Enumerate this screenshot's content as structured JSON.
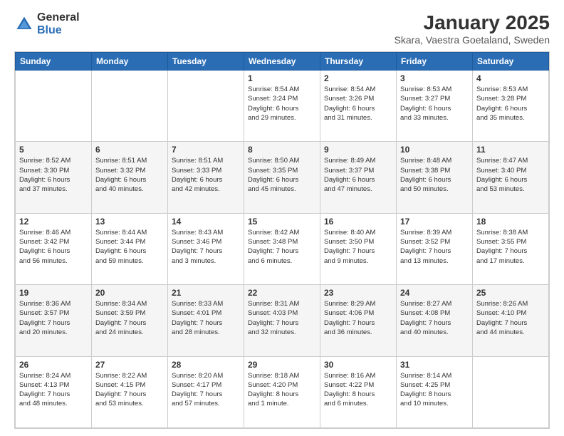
{
  "logo": {
    "general": "General",
    "blue": "Blue"
  },
  "title": "January 2025",
  "subtitle": "Skara, Vaestra Goetaland, Sweden",
  "days_of_week": [
    "Sunday",
    "Monday",
    "Tuesday",
    "Wednesday",
    "Thursday",
    "Friday",
    "Saturday"
  ],
  "weeks": [
    [
      {
        "day": "",
        "info": ""
      },
      {
        "day": "",
        "info": ""
      },
      {
        "day": "",
        "info": ""
      },
      {
        "day": "1",
        "info": "Sunrise: 8:54 AM\nSunset: 3:24 PM\nDaylight: 6 hours\nand 29 minutes."
      },
      {
        "day": "2",
        "info": "Sunrise: 8:54 AM\nSunset: 3:26 PM\nDaylight: 6 hours\nand 31 minutes."
      },
      {
        "day": "3",
        "info": "Sunrise: 8:53 AM\nSunset: 3:27 PM\nDaylight: 6 hours\nand 33 minutes."
      },
      {
        "day": "4",
        "info": "Sunrise: 8:53 AM\nSunset: 3:28 PM\nDaylight: 6 hours\nand 35 minutes."
      }
    ],
    [
      {
        "day": "5",
        "info": "Sunrise: 8:52 AM\nSunset: 3:30 PM\nDaylight: 6 hours\nand 37 minutes."
      },
      {
        "day": "6",
        "info": "Sunrise: 8:51 AM\nSunset: 3:32 PM\nDaylight: 6 hours\nand 40 minutes."
      },
      {
        "day": "7",
        "info": "Sunrise: 8:51 AM\nSunset: 3:33 PM\nDaylight: 6 hours\nand 42 minutes."
      },
      {
        "day": "8",
        "info": "Sunrise: 8:50 AM\nSunset: 3:35 PM\nDaylight: 6 hours\nand 45 minutes."
      },
      {
        "day": "9",
        "info": "Sunrise: 8:49 AM\nSunset: 3:37 PM\nDaylight: 6 hours\nand 47 minutes."
      },
      {
        "day": "10",
        "info": "Sunrise: 8:48 AM\nSunset: 3:38 PM\nDaylight: 6 hours\nand 50 minutes."
      },
      {
        "day": "11",
        "info": "Sunrise: 8:47 AM\nSunset: 3:40 PM\nDaylight: 6 hours\nand 53 minutes."
      }
    ],
    [
      {
        "day": "12",
        "info": "Sunrise: 8:46 AM\nSunset: 3:42 PM\nDaylight: 6 hours\nand 56 minutes."
      },
      {
        "day": "13",
        "info": "Sunrise: 8:44 AM\nSunset: 3:44 PM\nDaylight: 6 hours\nand 59 minutes."
      },
      {
        "day": "14",
        "info": "Sunrise: 8:43 AM\nSunset: 3:46 PM\nDaylight: 7 hours\nand 3 minutes."
      },
      {
        "day": "15",
        "info": "Sunrise: 8:42 AM\nSunset: 3:48 PM\nDaylight: 7 hours\nand 6 minutes."
      },
      {
        "day": "16",
        "info": "Sunrise: 8:40 AM\nSunset: 3:50 PM\nDaylight: 7 hours\nand 9 minutes."
      },
      {
        "day": "17",
        "info": "Sunrise: 8:39 AM\nSunset: 3:52 PM\nDaylight: 7 hours\nand 13 minutes."
      },
      {
        "day": "18",
        "info": "Sunrise: 8:38 AM\nSunset: 3:55 PM\nDaylight: 7 hours\nand 17 minutes."
      }
    ],
    [
      {
        "day": "19",
        "info": "Sunrise: 8:36 AM\nSunset: 3:57 PM\nDaylight: 7 hours\nand 20 minutes."
      },
      {
        "day": "20",
        "info": "Sunrise: 8:34 AM\nSunset: 3:59 PM\nDaylight: 7 hours\nand 24 minutes."
      },
      {
        "day": "21",
        "info": "Sunrise: 8:33 AM\nSunset: 4:01 PM\nDaylight: 7 hours\nand 28 minutes."
      },
      {
        "day": "22",
        "info": "Sunrise: 8:31 AM\nSunset: 4:03 PM\nDaylight: 7 hours\nand 32 minutes."
      },
      {
        "day": "23",
        "info": "Sunrise: 8:29 AM\nSunset: 4:06 PM\nDaylight: 7 hours\nand 36 minutes."
      },
      {
        "day": "24",
        "info": "Sunrise: 8:27 AM\nSunset: 4:08 PM\nDaylight: 7 hours\nand 40 minutes."
      },
      {
        "day": "25",
        "info": "Sunrise: 8:26 AM\nSunset: 4:10 PM\nDaylight: 7 hours\nand 44 minutes."
      }
    ],
    [
      {
        "day": "26",
        "info": "Sunrise: 8:24 AM\nSunset: 4:13 PM\nDaylight: 7 hours\nand 48 minutes."
      },
      {
        "day": "27",
        "info": "Sunrise: 8:22 AM\nSunset: 4:15 PM\nDaylight: 7 hours\nand 53 minutes."
      },
      {
        "day": "28",
        "info": "Sunrise: 8:20 AM\nSunset: 4:17 PM\nDaylight: 7 hours\nand 57 minutes."
      },
      {
        "day": "29",
        "info": "Sunrise: 8:18 AM\nSunset: 4:20 PM\nDaylight: 8 hours\nand 1 minute."
      },
      {
        "day": "30",
        "info": "Sunrise: 8:16 AM\nSunset: 4:22 PM\nDaylight: 8 hours\nand 6 minutes."
      },
      {
        "day": "31",
        "info": "Sunrise: 8:14 AM\nSunset: 4:25 PM\nDaylight: 8 hours\nand 10 minutes."
      },
      {
        "day": "",
        "info": ""
      }
    ]
  ]
}
